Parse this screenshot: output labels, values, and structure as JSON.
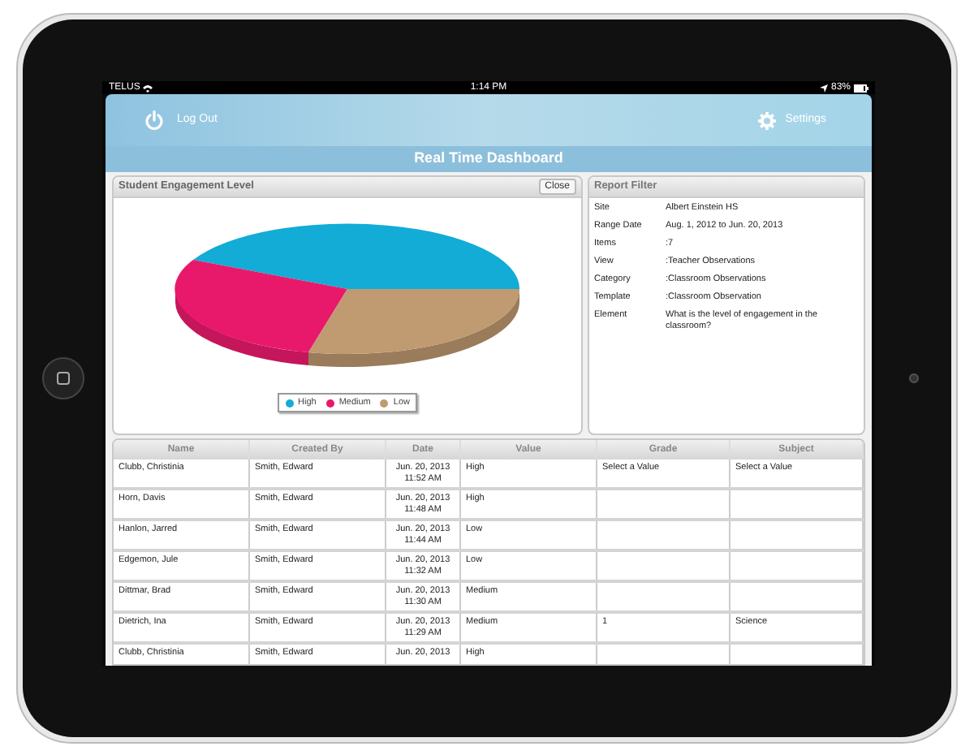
{
  "status_bar": {
    "carrier": "TELUS",
    "time": "1:14 PM",
    "battery": "83%"
  },
  "header": {
    "logout": "Log Out",
    "settings": "Settings"
  },
  "title": "Real Time Dashboard",
  "chart_panel": {
    "title": "Student Engagement Level",
    "close": "Close",
    "legend": [
      {
        "label": "High",
        "color": "#12acd6"
      },
      {
        "label": "Medium",
        "color": "#e8196b"
      },
      {
        "label": "Low",
        "color": "#c09a70"
      }
    ]
  },
  "filter_panel": {
    "title": "Report Filter",
    "rows": [
      {
        "label": "Site",
        "value": "Albert Einstein HS"
      },
      {
        "label": "Range Date",
        "value": "Aug. 1, 2012 to Jun. 20, 2013"
      },
      {
        "label": "Items",
        "value": ":7"
      },
      {
        "label": "View",
        "value": ":Teacher Observations"
      },
      {
        "label": "Category",
        "value": ":Classroom Observations"
      },
      {
        "label": "Template",
        "value": ":Classroom Observation"
      },
      {
        "label": "Element",
        "value": "What is the level of engagement in the classroom?"
      }
    ]
  },
  "table": {
    "columns": [
      "Name",
      "Created By",
      "Date",
      "Value",
      "Grade",
      "Subject"
    ],
    "rows": [
      [
        "Clubb, Christinia",
        "Smith, Edward",
        "Jun. 20, 2013\n11:52 AM",
        "High",
        "Select a Value",
        "Select a Value"
      ],
      [
        "Horn, Davis",
        "Smith, Edward",
        "Jun. 20, 2013\n11:48 AM",
        "High",
        "",
        ""
      ],
      [
        "Hanlon, Jarred",
        "Smith, Edward",
        "Jun. 20, 2013\n11:44 AM",
        "Low",
        "",
        ""
      ],
      [
        "Edgemon, Jule",
        "Smith, Edward",
        "Jun. 20, 2013\n11:32 AM",
        "Low",
        "",
        ""
      ],
      [
        "Dittmar, Brad",
        "Smith, Edward",
        "Jun. 20, 2013\n11:30 AM",
        "Medium",
        "",
        ""
      ],
      [
        "Dietrich, Ina",
        "Smith, Edward",
        "Jun. 20, 2013\n11:29 AM",
        "Medium",
        "1",
        "Science"
      ],
      [
        "Clubb, Christinia",
        "Smith, Edward",
        "Jun. 20, 2013",
        "High",
        "",
        ""
      ]
    ]
  }
}
